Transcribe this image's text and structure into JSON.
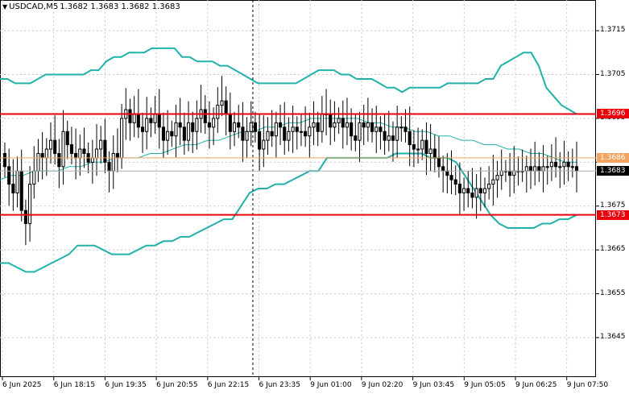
{
  "header": {
    "symbol": "USDCAD,M5",
    "ohlc": "1.3682 1.3683 1.3682 1.3683"
  },
  "colors": {
    "background": "#ffffff",
    "grid": "#c8c8c8",
    "candle": "#000000",
    "bollinger": "#20b2aa",
    "level_major": "#e8000b",
    "level_minor": "#f4a460",
    "current_price_tag": "#000000"
  },
  "chart_data": {
    "type": "candlestick",
    "symbol": "USDCAD",
    "timeframe": "M5",
    "ylim": [
      1.3636,
      1.3722
    ],
    "y_ticks": [
      "1.3715",
      "1.3705",
      "1.3695",
      "1.3685",
      "1.3675",
      "1.3665",
      "1.3655",
      "1.3645"
    ],
    "x_ticks": [
      "6 Jun 2025",
      "6 Jun 18:15",
      "6 Jun 19:35",
      "6 Jun 20:55",
      "6 Jun 22:15",
      "6 Jun 23:35",
      "9 Jun 01:00",
      "9 Jun 02:20",
      "9 Jun 03:45",
      "9 Jun 05:05",
      "9 Jun 06:25",
      "9 Jun 07:50"
    ],
    "grid": true,
    "session_break_index": 60,
    "levels": [
      {
        "value": 1.3696,
        "label": "1.3696",
        "style": "major"
      },
      {
        "value": 1.3686,
        "label": "1.3686",
        "style": "minor"
      },
      {
        "value": 1.3673,
        "label": "1.3673",
        "style": "major"
      }
    ],
    "current_price": {
      "value": 1.3683,
      "label": "1.3683"
    },
    "close": [
      1.3684,
      1.368,
      1.3678,
      1.3683,
      1.3674,
      1.3671,
      1.368,
      1.3683,
      1.3687,
      1.3686,
      1.3688,
      1.369,
      1.3687,
      1.3684,
      1.3692,
      1.3689,
      1.3687,
      1.3686,
      1.3688,
      1.3687,
      1.3685,
      1.3686,
      1.3688,
      1.369,
      1.3685,
      1.3683,
      1.3687,
      1.3686,
      1.3695,
      1.3697,
      1.3694,
      1.3696,
      1.3693,
      1.3692,
      1.3695,
      1.3694,
      1.3696,
      1.3693,
      1.369,
      1.3692,
      1.3691,
      1.3694,
      1.3693,
      1.369,
      1.3694,
      1.3692,
      1.3695,
      1.3697,
      1.3694,
      1.3693,
      1.3695,
      1.3698,
      1.3699,
      1.3696,
      1.3692,
      1.3694,
      1.3693,
      1.369,
      1.3692,
      1.3694,
      1.3692,
      1.3688,
      1.369,
      1.3692,
      1.3691,
      1.3694,
      1.3693,
      1.369,
      1.3692,
      1.3693,
      1.3692,
      1.3692,
      1.3691,
      1.3693,
      1.3694,
      1.3692,
      1.3696,
      1.3696,
      1.3693,
      1.3694,
      1.3695,
      1.3693,
      1.3694,
      1.3691,
      1.369,
      1.3694,
      1.3693,
      1.3694,
      1.3692,
      1.3693,
      1.3692,
      1.369,
      1.3691,
      1.369,
      1.3693,
      1.3693,
      1.3692,
      1.3689,
      1.3688,
      1.3688,
      1.369,
      1.3687,
      1.3688,
      1.3686,
      1.3684,
      1.3683,
      1.3682,
      1.3681,
      1.368,
      1.3678,
      1.3679,
      1.3678,
      1.3677,
      1.3679,
      1.3678,
      1.3679,
      1.368,
      1.3681,
      1.3682,
      1.3683,
      1.3683,
      1.3682,
      1.3683,
      1.3683,
      1.3683,
      1.3684,
      1.3683,
      1.3684,
      1.3683,
      1.3684,
      1.3684,
      1.3685,
      1.3684,
      1.3684,
      1.3685,
      1.3684,
      1.3684,
      1.3683
    ],
    "bb_upper": [
      1.3704,
      1.3704,
      1.3703,
      1.3703,
      1.3703,
      1.3704,
      1.3705,
      1.3705,
      1.3705,
      1.3705,
      1.3705,
      1.3705,
      1.3706,
      1.3706,
      1.3708,
      1.3709,
      1.3709,
      1.371,
      1.371,
      1.371,
      1.3711,
      1.3711,
      1.3711,
      1.3711,
      1.3709,
      1.3709,
      1.3708,
      1.3708,
      1.3708,
      1.3707,
      1.3707,
      1.3706,
      1.3705,
      1.3704,
      1.3703,
      1.3703,
      1.3703,
      1.3703,
      1.3703,
      1.3703,
      1.3704,
      1.3705,
      1.3706,
      1.3706,
      1.3706,
      1.3705,
      1.3705,
      1.3704,
      1.3704,
      1.3704,
      1.3703,
      1.3702,
      1.3702,
      1.3701,
      1.3702,
      1.3702,
      1.3702,
      1.3702,
      1.3702,
      1.3703,
      1.3703,
      1.3703,
      1.3703,
      1.3703,
      1.3704,
      1.3704,
      1.3707,
      1.3708,
      1.3709,
      1.371,
      1.371,
      1.3707,
      1.3702,
      1.37,
      1.3698,
      1.3697,
      1.3696
    ],
    "bb_middle": [
      1.3681,
      1.3682,
      1.3682,
      1.3683,
      1.3683,
      1.3683,
      1.3684,
      1.3684,
      1.3685,
      1.3685,
      1.3686,
      1.3686,
      1.3686,
      1.3687,
      1.3687,
      1.3688,
      1.3689,
      1.3689,
      1.369,
      1.369,
      1.3691,
      1.3692,
      1.3692,
      1.3693,
      1.3693,
      1.3694,
      1.3694,
      1.3695,
      1.3695,
      1.3695,
      1.3695,
      1.3695,
      1.3694,
      1.3694,
      1.3693,
      1.3693,
      1.3692,
      1.3692,
      1.3691,
      1.3691,
      1.369,
      1.369,
      1.3689,
      1.3689,
      1.3688,
      1.3688,
      1.3687,
      1.3687,
      1.3686,
      1.3685,
      1.3685
    ],
    "bb_lower": [
      1.3662,
      1.3662,
      1.3661,
      1.366,
      1.366,
      1.3661,
      1.3662,
      1.3663,
      1.3664,
      1.3666,
      1.3666,
      1.3666,
      1.3665,
      1.3664,
      1.3664,
      1.3664,
      1.3665,
      1.3666,
      1.3666,
      1.3667,
      1.3667,
      1.3668,
      1.3668,
      1.3669,
      1.367,
      1.3671,
      1.3672,
      1.3672,
      1.3675,
      1.3678,
      1.3679,
      1.3679,
      1.368,
      1.368,
      1.3681,
      1.3682,
      1.3683,
      1.3683,
      1.3686,
      1.3686,
      1.3686,
      1.3686,
      1.3686,
      1.3686,
      1.3686,
      1.3686,
      1.3687,
      1.3687,
      1.3687,
      1.3687,
      1.3686,
      1.3686,
      1.3686,
      1.3685,
      1.3682,
      1.3679,
      1.3676,
      1.3673,
      1.3671,
      1.367,
      1.367,
      1.367,
      1.367,
      1.3671,
      1.3671,
      1.3672,
      1.3672,
      1.3673
    ]
  }
}
